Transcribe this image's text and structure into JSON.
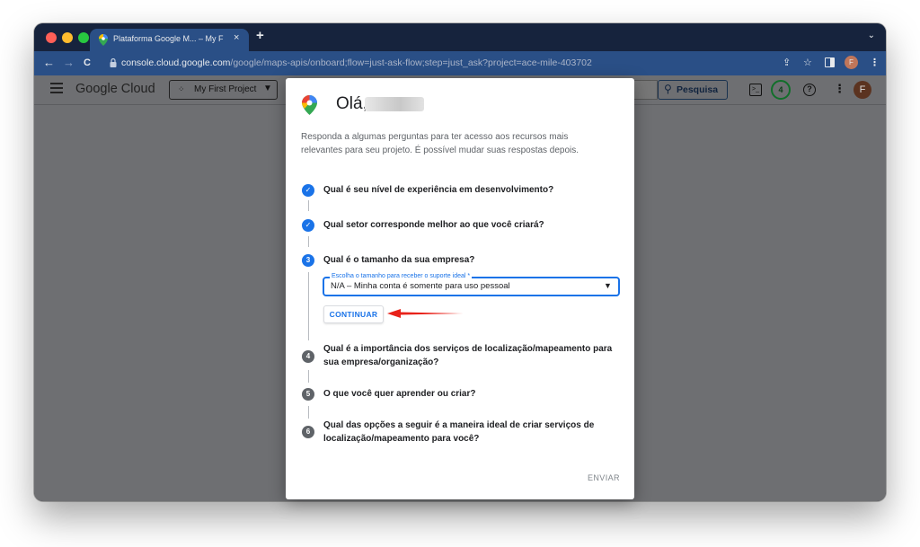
{
  "browser": {
    "tab_title": "Plataforma Google M... – My F",
    "tab_close": "×",
    "new_tab": "+",
    "tab_menu": "⌄",
    "back": "←",
    "forward": "→",
    "reload": "C",
    "url_host": "console.cloud.google.com",
    "url_path": "/google/maps-apis/onboard;flow=just-ask-flow;step=just_ask?project=ace-mile-403702",
    "toolbar_icons": [
      "share-icon",
      "star-icon",
      "sidebar-icon",
      "profile-icon",
      "menu-icon"
    ],
    "profile_initial": "F"
  },
  "header": {
    "logo": "Google Cloud",
    "project_label": "My First Project",
    "search_button": "Pesquisa",
    "notification_count": "4",
    "avatar_initial": "F"
  },
  "dialog": {
    "greeting": "Olá,",
    "intro": "Responda a algumas perguntas para ter acesso aos recursos mais relevantes para seu projeto. É possível mudar suas respostas depois.",
    "steps": [
      {
        "number": "1",
        "status": "done",
        "text": "Qual é seu nível de experiência em desenvolvimento?"
      },
      {
        "number": "2",
        "status": "done",
        "text": "Qual setor corresponde melhor ao que você criará?"
      },
      {
        "number": "3",
        "status": "active",
        "text": "Qual é o tamanho da sua empresa?"
      },
      {
        "number": "4",
        "status": "idle",
        "text": "Qual é a importância dos serviços de localização/mapeamento para sua empresa/organização?"
      },
      {
        "number": "5",
        "status": "idle",
        "text": "O que você quer aprender ou criar?"
      },
      {
        "number": "6",
        "status": "idle",
        "text": "Qual das opções a seguir é a maneira ideal de criar serviços de localização/mapeamento para você?"
      }
    ],
    "select_label": "Escolha o tamanho para receber o suporte ideal *",
    "select_value": "N/A – Minha conta é somente para uso pessoal",
    "continue_button": "CONTINUAR",
    "submit_button": "ENVIAR"
  },
  "colors": {
    "accent": "#1a73e8",
    "annotation_arrow": "#e8221a",
    "tabbar": "#16233d",
    "toolbar": "#2a4f86",
    "backdrop": "#6e6f72"
  }
}
